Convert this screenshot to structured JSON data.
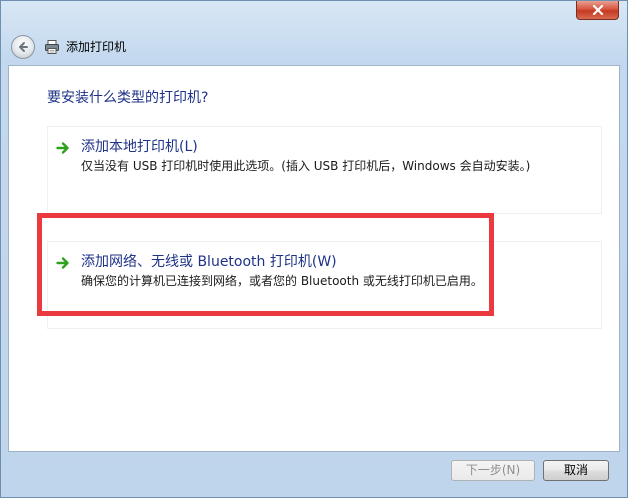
{
  "window": {
    "nav_title": "添加打印机"
  },
  "main": {
    "question": "要安装什么类型的打印机?",
    "options": [
      {
        "title": "添加本地打印机(L)",
        "description": "仅当没有 USB 打印机时使用此选项。(插入 USB 打印机后，Windows 会自动安装。)"
      },
      {
        "title": "添加网络、无线或 Bluetooth 打印机(W)",
        "description": "确保您的计算机已连接到网络，或者您的 Bluetooth 或无线打印机已启用。"
      }
    ]
  },
  "footer": {
    "next_label": "下一步(N)",
    "cancel_label": "取消"
  },
  "colors": {
    "link_blue": "#1e3287",
    "highlight_red": "#ea3a3f",
    "arrow_green": "#2ea41e"
  },
  "icons": {
    "close": "close-icon",
    "back": "back-arrow-icon",
    "printer": "printer-icon",
    "option_arrow": "green-arrow-icon"
  }
}
